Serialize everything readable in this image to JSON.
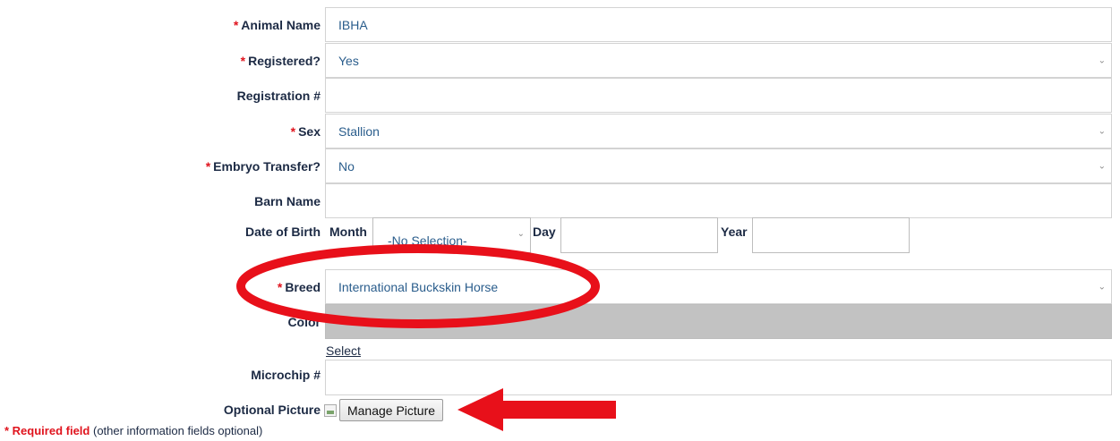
{
  "form": {
    "animal_name": {
      "label": "Animal Name",
      "value": "IBHA",
      "required": true
    },
    "registered": {
      "label": "Registered?",
      "value": "Yes",
      "required": true
    },
    "registration_number": {
      "label": "Registration #",
      "value": ""
    },
    "sex": {
      "label": "Sex",
      "value": "Stallion",
      "required": true
    },
    "embryo_transfer": {
      "label": "Embryo Transfer?",
      "value": "No",
      "required": true
    },
    "barn_name": {
      "label": "Barn Name",
      "value": ""
    },
    "dob": {
      "label": "Date of Birth",
      "month_label": "Month",
      "month_value": "-No Selection-",
      "day_label": "Day",
      "year_label": "Year"
    },
    "breed": {
      "label": "Breed",
      "value": "International Buckskin Horse",
      "required": true
    },
    "color": {
      "label": "Color",
      "select_link": "Select"
    },
    "microchip": {
      "label": "Microchip #",
      "value": ""
    },
    "picture": {
      "label": "Optional Picture",
      "button": "Manage Picture"
    }
  },
  "footer": {
    "required_marker": "* Required field",
    "note": "(other information fields optional)"
  },
  "required_star": "*",
  "colors": {
    "annotation": "#e8101a",
    "required": "#e0141e",
    "value_text": "#2a5d8c"
  }
}
